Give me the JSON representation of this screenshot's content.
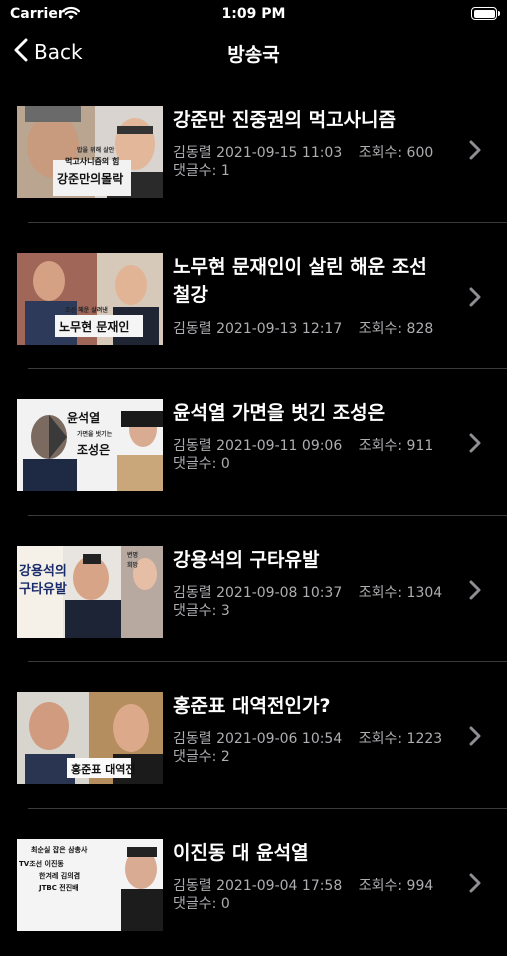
{
  "status": {
    "carrier": "Carrier",
    "time": "1:09 PM"
  },
  "nav": {
    "back_label": "Back",
    "title": "방송국"
  },
  "items": [
    {
      "title": "강준만 진중권의 먹고사니즘",
      "author": "김동렬",
      "date": "2021-09-15 11:03",
      "views_label": "조회수:",
      "views": "600",
      "comments_label": "댓글수:",
      "comments": "1",
      "thumb_text": [
        "밥을 위해 살안",
        "먹고사니즘의 힘",
        "강준만의몰락"
      ]
    },
    {
      "title": "노무현 문재인이 살린 해운 조선 철강",
      "author": "김동렬",
      "date": "2021-09-13 12:17",
      "views_label": "조회수:",
      "views": "828",
      "comments_label": "",
      "comments": "",
      "thumb_text": [
        "조선 해운 살려낸",
        "노무현 문재인"
      ]
    },
    {
      "title": "윤석열 가면을 벗긴 조성은",
      "author": "김동렬",
      "date": "2021-09-11 09:06",
      "views_label": "조회수:",
      "views": "911",
      "comments_label": "댓글수:",
      "comments": "0",
      "thumb_text": [
        "윤석열",
        "가면을 벗기는",
        "조성은"
      ]
    },
    {
      "title": "강용석의 구타유발",
      "author": "김동렬",
      "date": "2021-09-08 10:37",
      "views_label": "조회수:",
      "views": "1304",
      "comments_label": "댓글수:",
      "comments": "3",
      "thumb_text": [
        "강용석의",
        "구타유발",
        "변명",
        "희망"
      ]
    },
    {
      "title": "홍준표 대역전인가?",
      "author": "김동렬",
      "date": "2021-09-06 10:54",
      "views_label": "조회수:",
      "views": "1223",
      "comments_label": "댓글수:",
      "comments": "2",
      "thumb_text": [
        "홍준표 대역전"
      ]
    },
    {
      "title": "이진동 대 윤석열",
      "author": "김동렬",
      "date": "2021-09-04 17:58",
      "views_label": "조회수:",
      "views": "994",
      "comments_label": "댓글수:",
      "comments": "0",
      "thumb_text": [
        "최순실 잡은 삼총사",
        "TV조선 이진동",
        "한겨레 김의겸",
        "JTBC 전진배"
      ]
    }
  ],
  "icons": {
    "back": "chevron-left-icon",
    "row": "chevron-right-icon",
    "wifi": "wifi-icon",
    "battery": "battery-icon"
  },
  "colors": {
    "background": "#000000",
    "meta": "#aeaeb2",
    "divider": "#3a3a3c",
    "chevron": "#8e8e93"
  }
}
